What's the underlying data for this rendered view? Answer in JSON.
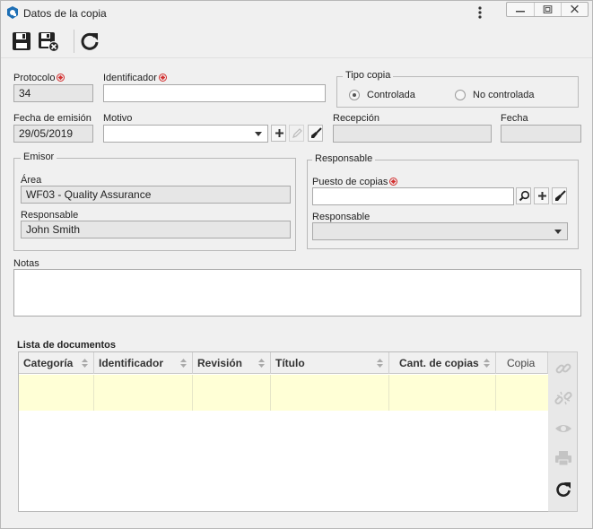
{
  "window": {
    "title": "Datos de la copia"
  },
  "form": {
    "protocolo": {
      "label": "Protocolo",
      "value": "34"
    },
    "identificador": {
      "label": "Identificador",
      "value": ""
    },
    "tipo_copia": {
      "legend": "Tipo copia",
      "options": [
        {
          "label": "Controlada",
          "selected": true
        },
        {
          "label": "No controlada",
          "selected": false
        }
      ]
    },
    "fecha_emision": {
      "label": "Fecha de emisión",
      "value": "29/05/2019"
    },
    "motivo": {
      "label": "Motivo",
      "value": ""
    },
    "recepcion": {
      "label": "Recepción",
      "value": ""
    },
    "fecha": {
      "label": "Fecha",
      "value": ""
    },
    "emisor": {
      "legend": "Emisor",
      "area_label": "Área",
      "area_value": "WF03 - Quality Assurance",
      "responsable_label": "Responsable",
      "responsable_value": "John Smith"
    },
    "responsable": {
      "legend": "Responsable",
      "puesto_label": "Puesto de copias",
      "puesto_value": "",
      "responsable_label": "Responsable",
      "responsable_value": ""
    },
    "notas": {
      "label": "Notas",
      "value": ""
    }
  },
  "documents": {
    "title": "Lista de documentos",
    "columns": [
      "Categoría",
      "Identificador",
      "Revisión",
      "Título",
      "Cant. de copias",
      "Copia"
    ],
    "rows": [
      [
        "",
        "",
        "",
        "",
        "",
        ""
      ]
    ]
  },
  "colors": {
    "accent": "#1e6fb5",
    "required": "#d32f2f",
    "selected_row": "#ffffd6"
  }
}
